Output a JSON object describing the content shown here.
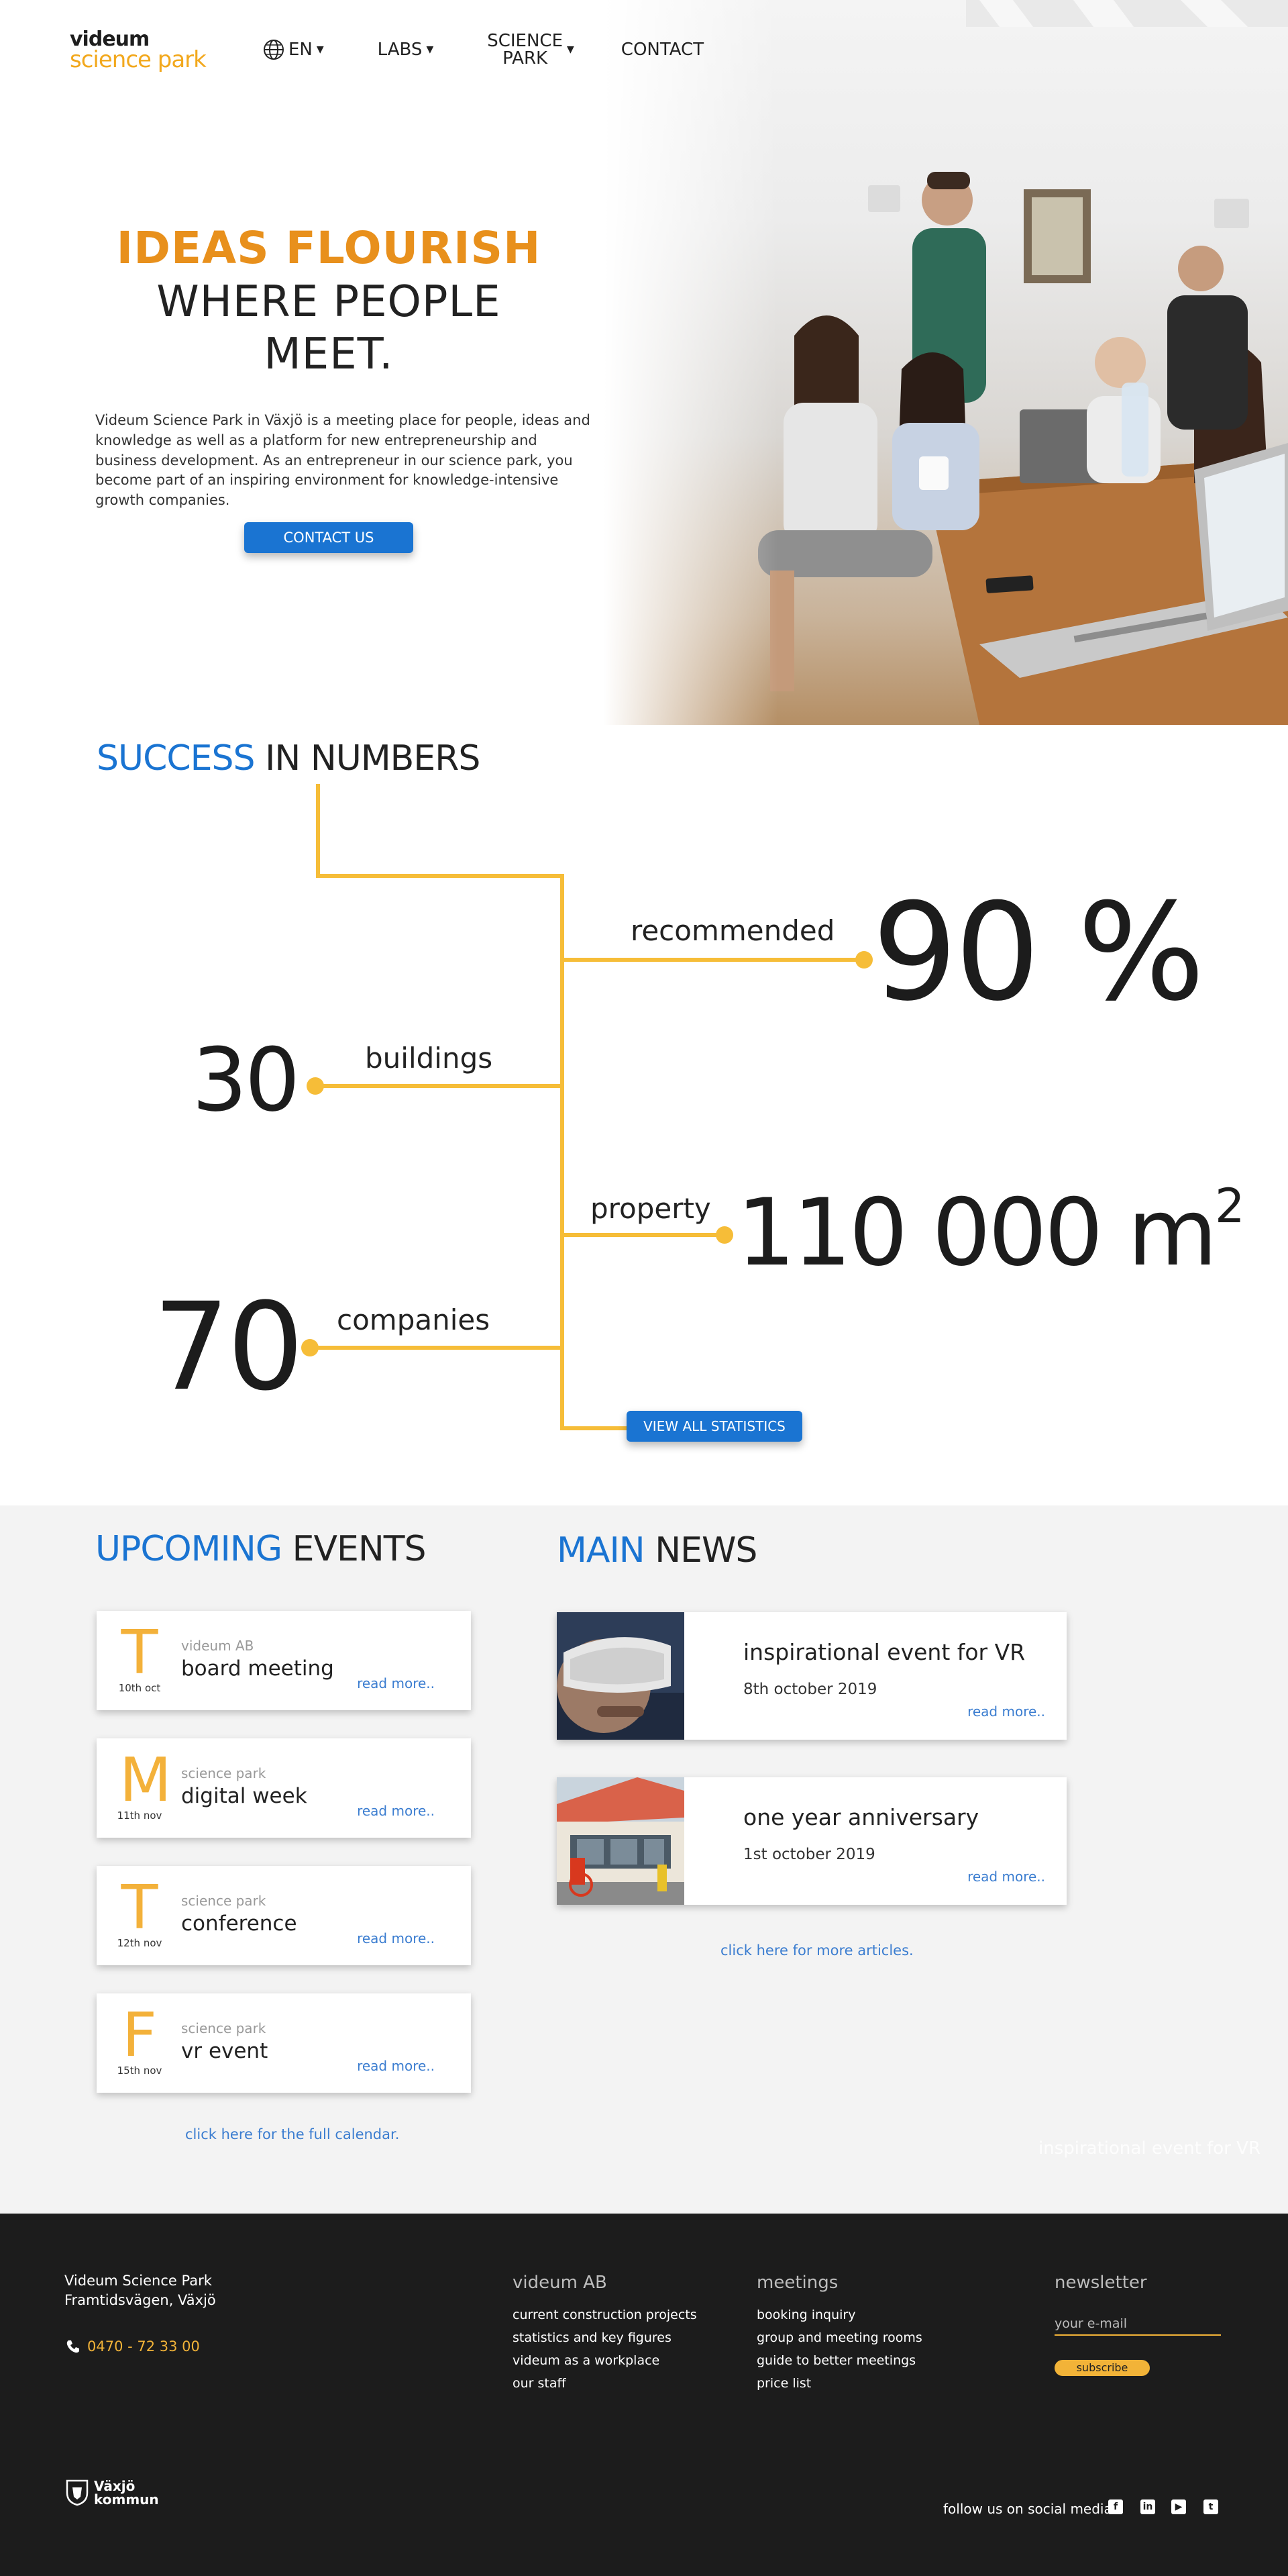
{
  "header": {
    "logo_line1": "videum",
    "logo_line2": "science park",
    "nav": {
      "lang": "EN",
      "labs": "LABS",
      "science_park_1": "SCIENCE",
      "science_park_2": "PARK",
      "contact": "CONTACT"
    }
  },
  "hero": {
    "title_highlight": "IDEAS FLOURISH",
    "title_line2": "WHERE PEOPLE",
    "title_line3": "MEET.",
    "body": "Videum Science Park in Växjö is a meeting place for people, ideas and knowledge as well as a platform for new entrepreneurship and business development. As an entrepreneur in our science park, you become part of an inspiring environment for knowledge-intensive growth companies.",
    "button": "CONTACT US"
  },
  "stats": {
    "title_highlight": "SUCCESS",
    "title_rest": "IN NUMBERS",
    "items": [
      {
        "label": "recommended",
        "value": "90 %"
      },
      {
        "label": "buildings",
        "value": "30"
      },
      {
        "label": "property",
        "value": "110 000 m",
        "sup": "2"
      },
      {
        "label": "companies",
        "value": "70"
      }
    ],
    "button": "VIEW ALL STATISTICS",
    "accent_color": "#f6bd38"
  },
  "events": {
    "title_highlight": "UPCOMING",
    "title_rest": "EVENTS",
    "items": [
      {
        "letter": "T",
        "date": "10th oct",
        "org": "videum AB",
        "name": "board meeting",
        "more": "read more.."
      },
      {
        "letter": "M",
        "date": "11th nov",
        "org": "science park",
        "name": "digital week",
        "more": "read more.."
      },
      {
        "letter": "T",
        "date": "12th nov",
        "org": "science park",
        "name": "conference",
        "more": "read more.."
      },
      {
        "letter": "F",
        "date": "15th nov",
        "org": "science park",
        "name": "vr event",
        "more": "read more.."
      }
    ],
    "full_calendar": "click here for the full calendar."
  },
  "news": {
    "title_highlight": "MAIN",
    "title_rest": "NEWS",
    "items": [
      {
        "title": "inspirational event for VR",
        "date": "8th october 2019",
        "more": "read more.."
      },
      {
        "title": "one year anniversary",
        "date": "1st october 2019",
        "more": "read more.."
      }
    ],
    "more_articles": "click here for more articles.",
    "ghost_text": "inspirational event for VR"
  },
  "footer": {
    "address_line1": "Videum Science Park",
    "address_line2": "Framtidsvägen, Växjö",
    "phone": "0470 - 72 33 00",
    "col_videum": {
      "heading": "videum AB",
      "links": [
        "current construction projects",
        "statistics and key figures",
        "videum as a workplace",
        "our staff"
      ]
    },
    "col_meetings": {
      "heading": "meetings",
      "links": [
        "booking inquiry",
        "group and meeting rooms",
        "guide to better meetings",
        "price list"
      ]
    },
    "newsletter": {
      "heading": "newsletter",
      "placeholder": "your e-mail",
      "button": "subscribe"
    },
    "kommun_line1": "Växjö",
    "kommun_line2": "kommun",
    "social_label": "follow us on social media",
    "social_icons": [
      "facebook-icon",
      "linkedin-icon",
      "youtube-icon",
      "twitter-icon"
    ]
  }
}
